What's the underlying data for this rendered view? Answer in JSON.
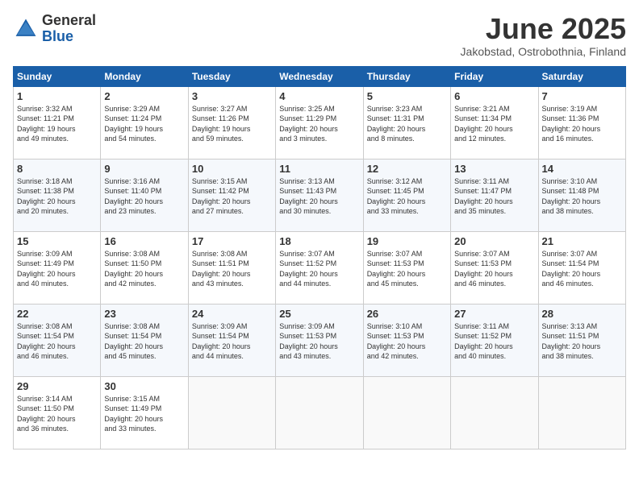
{
  "logo": {
    "general": "General",
    "blue": "Blue"
  },
  "header": {
    "month": "June 2025",
    "location": "Jakobstad, Ostrobothnia, Finland"
  },
  "days_of_week": [
    "Sunday",
    "Monday",
    "Tuesday",
    "Wednesday",
    "Thursday",
    "Friday",
    "Saturday"
  ],
  "weeks": [
    [
      {
        "day": "1",
        "info": "Sunrise: 3:32 AM\nSunset: 11:21 PM\nDaylight: 19 hours\nand 49 minutes."
      },
      {
        "day": "2",
        "info": "Sunrise: 3:29 AM\nSunset: 11:24 PM\nDaylight: 19 hours\nand 54 minutes."
      },
      {
        "day": "3",
        "info": "Sunrise: 3:27 AM\nSunset: 11:26 PM\nDaylight: 19 hours\nand 59 minutes."
      },
      {
        "day": "4",
        "info": "Sunrise: 3:25 AM\nSunset: 11:29 PM\nDaylight: 20 hours\nand 3 minutes."
      },
      {
        "day": "5",
        "info": "Sunrise: 3:23 AM\nSunset: 11:31 PM\nDaylight: 20 hours\nand 8 minutes."
      },
      {
        "day": "6",
        "info": "Sunrise: 3:21 AM\nSunset: 11:34 PM\nDaylight: 20 hours\nand 12 minutes."
      },
      {
        "day": "7",
        "info": "Sunrise: 3:19 AM\nSunset: 11:36 PM\nDaylight: 20 hours\nand 16 minutes."
      }
    ],
    [
      {
        "day": "8",
        "info": "Sunrise: 3:18 AM\nSunset: 11:38 PM\nDaylight: 20 hours\nand 20 minutes."
      },
      {
        "day": "9",
        "info": "Sunrise: 3:16 AM\nSunset: 11:40 PM\nDaylight: 20 hours\nand 23 minutes."
      },
      {
        "day": "10",
        "info": "Sunrise: 3:15 AM\nSunset: 11:42 PM\nDaylight: 20 hours\nand 27 minutes."
      },
      {
        "day": "11",
        "info": "Sunrise: 3:13 AM\nSunset: 11:43 PM\nDaylight: 20 hours\nand 30 minutes."
      },
      {
        "day": "12",
        "info": "Sunrise: 3:12 AM\nSunset: 11:45 PM\nDaylight: 20 hours\nand 33 minutes."
      },
      {
        "day": "13",
        "info": "Sunrise: 3:11 AM\nSunset: 11:47 PM\nDaylight: 20 hours\nand 35 minutes."
      },
      {
        "day": "14",
        "info": "Sunrise: 3:10 AM\nSunset: 11:48 PM\nDaylight: 20 hours\nand 38 minutes."
      }
    ],
    [
      {
        "day": "15",
        "info": "Sunrise: 3:09 AM\nSunset: 11:49 PM\nDaylight: 20 hours\nand 40 minutes."
      },
      {
        "day": "16",
        "info": "Sunrise: 3:08 AM\nSunset: 11:50 PM\nDaylight: 20 hours\nand 42 minutes."
      },
      {
        "day": "17",
        "info": "Sunrise: 3:08 AM\nSunset: 11:51 PM\nDaylight: 20 hours\nand 43 minutes."
      },
      {
        "day": "18",
        "info": "Sunrise: 3:07 AM\nSunset: 11:52 PM\nDaylight: 20 hours\nand 44 minutes."
      },
      {
        "day": "19",
        "info": "Sunrise: 3:07 AM\nSunset: 11:53 PM\nDaylight: 20 hours\nand 45 minutes."
      },
      {
        "day": "20",
        "info": "Sunrise: 3:07 AM\nSunset: 11:53 PM\nDaylight: 20 hours\nand 46 minutes."
      },
      {
        "day": "21",
        "info": "Sunrise: 3:07 AM\nSunset: 11:54 PM\nDaylight: 20 hours\nand 46 minutes."
      }
    ],
    [
      {
        "day": "22",
        "info": "Sunrise: 3:08 AM\nSunset: 11:54 PM\nDaylight: 20 hours\nand 46 minutes."
      },
      {
        "day": "23",
        "info": "Sunrise: 3:08 AM\nSunset: 11:54 PM\nDaylight: 20 hours\nand 45 minutes."
      },
      {
        "day": "24",
        "info": "Sunrise: 3:09 AM\nSunset: 11:54 PM\nDaylight: 20 hours\nand 44 minutes."
      },
      {
        "day": "25",
        "info": "Sunrise: 3:09 AM\nSunset: 11:53 PM\nDaylight: 20 hours\nand 43 minutes."
      },
      {
        "day": "26",
        "info": "Sunrise: 3:10 AM\nSunset: 11:53 PM\nDaylight: 20 hours\nand 42 minutes."
      },
      {
        "day": "27",
        "info": "Sunrise: 3:11 AM\nSunset: 11:52 PM\nDaylight: 20 hours\nand 40 minutes."
      },
      {
        "day": "28",
        "info": "Sunrise: 3:13 AM\nSunset: 11:51 PM\nDaylight: 20 hours\nand 38 minutes."
      }
    ],
    [
      {
        "day": "29",
        "info": "Sunrise: 3:14 AM\nSunset: 11:50 PM\nDaylight: 20 hours\nand 36 minutes."
      },
      {
        "day": "30",
        "info": "Sunrise: 3:15 AM\nSunset: 11:49 PM\nDaylight: 20 hours\nand 33 minutes."
      },
      {
        "day": "",
        "info": ""
      },
      {
        "day": "",
        "info": ""
      },
      {
        "day": "",
        "info": ""
      },
      {
        "day": "",
        "info": ""
      },
      {
        "day": "",
        "info": ""
      }
    ]
  ]
}
